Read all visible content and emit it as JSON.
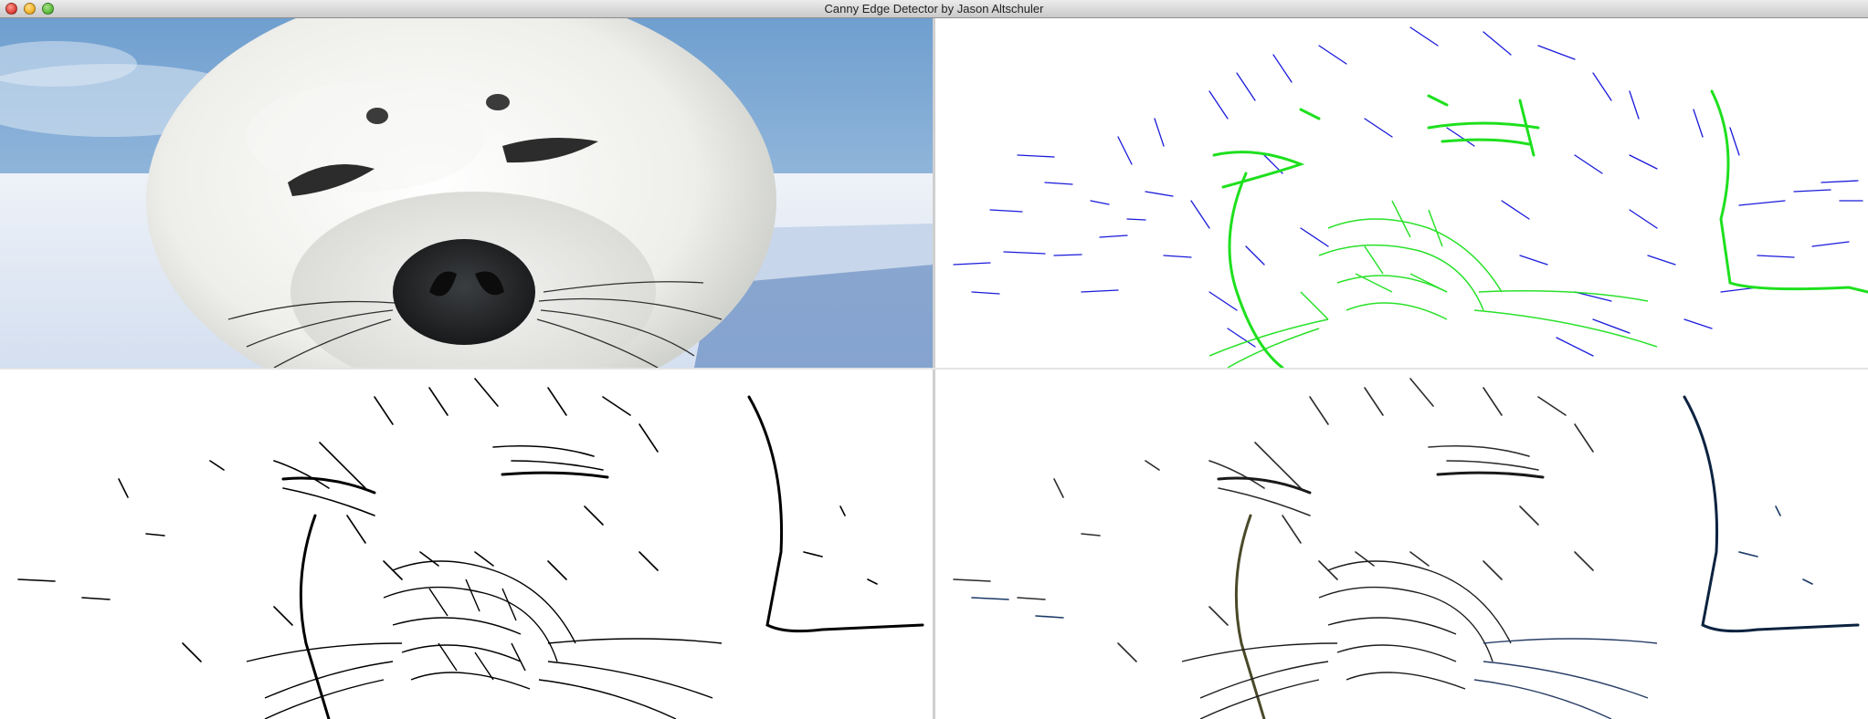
{
  "window": {
    "title": "Canny Edge Detector by Jason Altschuler",
    "controls": {
      "close_icon": "close-icon",
      "minimize_icon": "minimize-icon",
      "zoom_icon": "zoom-icon"
    }
  },
  "panels": [
    {
      "id": "original",
      "content": "photo of a harp seal pup on snow"
    },
    {
      "id": "gradient",
      "content": "edge strength visualization in blue and green on white"
    },
    {
      "id": "edges",
      "content": "black edge map on white"
    },
    {
      "id": "colored-edges",
      "content": "edge map tinted with original colors on white"
    }
  ],
  "colors": {
    "sky": "#8fb4da",
    "snow": "#e9eef6",
    "fur": "#f2f2f0",
    "nose": "#2a2d30",
    "weak_edge": "#1a1adb",
    "strong_edge": "#1ee01e",
    "edge": "#000000",
    "tinted_edge_dark": "#0c2340"
  }
}
